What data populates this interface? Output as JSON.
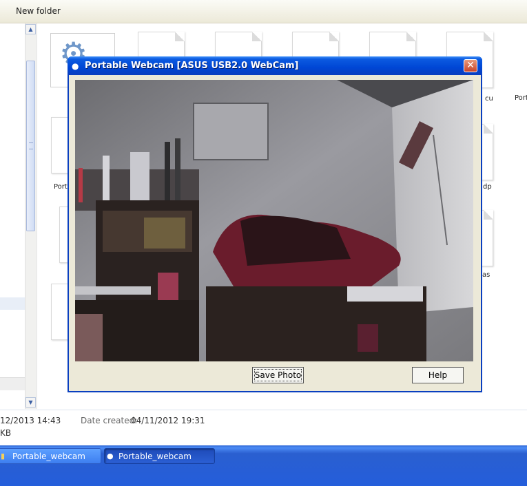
{
  "explorer": {
    "toolbar": {
      "new_folder_label": "New folder"
    },
    "files": [
      {
        "label": "Port"
      },
      {
        "label": "Port"
      },
      {
        "label": "cu"
      },
      {
        "label": "dp"
      },
      {
        "label": "as"
      }
    ],
    "details": {
      "date_modified_value": "12/2013 14:43",
      "size_value": "KB",
      "date_created_label": "Date created:",
      "date_created_value": "04/11/2012 19:31"
    }
  },
  "dialog": {
    "title": "Portable Webcam  [ASUS USB2.0 WebCam]",
    "close_glyph": "✕",
    "save_photo_label": "Save Photo",
    "help_label": "Help"
  },
  "taskbar": {
    "buttons": [
      {
        "label": "Portable_webcam",
        "icon": "folder-icon",
        "active": false
      },
      {
        "label": "Portable_webcam",
        "icon": "webcam-icon",
        "active": true
      }
    ]
  },
  "colors": {
    "title_bar": "#0046d5",
    "taskbar": "#245edb",
    "close_button": "#c8452a",
    "dialog_face": "#ece9d8"
  }
}
